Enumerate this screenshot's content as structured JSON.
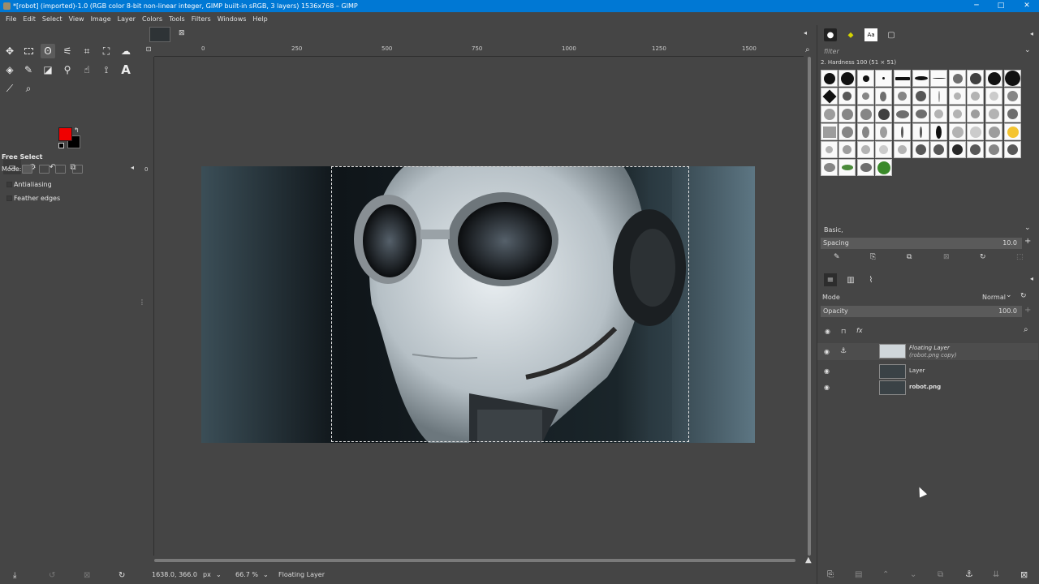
{
  "window": {
    "title": "*[robot] (imported)-1.0 (RGB color 8-bit non-linear integer, GIMP built-in sRGB, 3 layers) 1536x768 – GIMP"
  },
  "menu": [
    "File",
    "Edit",
    "Select",
    "View",
    "Image",
    "Layer",
    "Colors",
    "Tools",
    "Filters",
    "Windows",
    "Help"
  ],
  "toolbox": {
    "tools": [
      "move-icon",
      "rect-select-icon",
      "free-select-icon",
      "fuzzy-select-icon",
      "crop-icon",
      "unified-transform-icon",
      "warp-icon",
      "bucket-fill-icon",
      "paintbrush-icon",
      "eraser-icon",
      "clone-icon",
      "smudge-icon",
      "path-icon",
      "text-icon",
      "color-picker-icon",
      "zoom-icon"
    ],
    "fg_color": "#f00000",
    "bg_color": "#000000"
  },
  "tool_options": {
    "title": "Free Select",
    "mode_label": "Mode:",
    "antialiasing": "Antialiasing",
    "feather_edges": "Feather edges"
  },
  "ruler": {
    "h_ticks": [
      "0",
      "250",
      "500",
      "750",
      "1000",
      "1250",
      "1500"
    ],
    "v_ticks": [
      "0"
    ]
  },
  "statusbar": {
    "coords": "1638.0, 366.0",
    "unit": "px",
    "zoom": "66.7 %",
    "layer": "Floating Layer"
  },
  "brushes": {
    "filter_placeholder": "filter",
    "current": "2. Hardness 100 (51 × 51)",
    "preset": "Basic,",
    "spacing_label": "Spacing",
    "spacing_value": "10.0"
  },
  "layers": {
    "mode_label": "Mode",
    "mode_value": "Normal",
    "opacity_label": "Opacity",
    "opacity_value": "100.0",
    "items": [
      {
        "name": "Floating Layer",
        "sub": "(robot.png copy)"
      },
      {
        "name": "Layer",
        "sub": ""
      },
      {
        "name": "robot.png",
        "sub": ""
      }
    ]
  }
}
